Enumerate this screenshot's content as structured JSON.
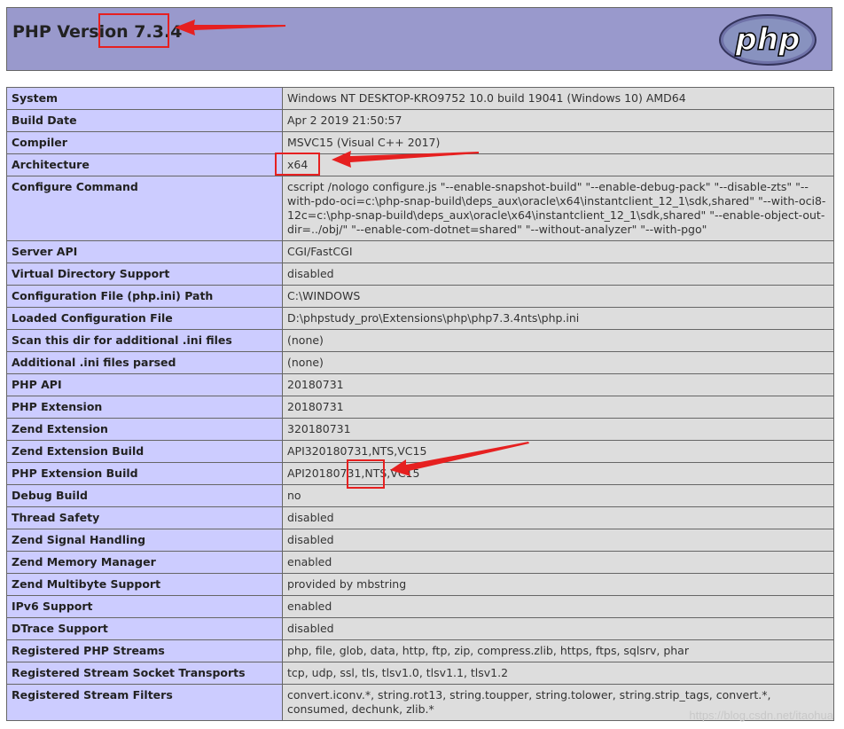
{
  "header": {
    "title": "PHP Version 7.3.4",
    "logo_text": "php"
  },
  "rows": [
    {
      "key": "System",
      "value": "Windows NT DESKTOP-KRO9752 10.0 build 19041 (Windows 10) AMD64"
    },
    {
      "key": "Build Date",
      "value": "Apr 2 2019 21:50:57"
    },
    {
      "key": "Compiler",
      "value": "MSVC15 (Visual C++ 2017)"
    },
    {
      "key": "Architecture",
      "value": "x64"
    },
    {
      "key": "Configure Command",
      "value": "cscript /nologo configure.js \"--enable-snapshot-build\" \"--enable-debug-pack\" \"--disable-zts\" \"--with-pdo-oci=c:\\php-snap-build\\deps_aux\\oracle\\x64\\instantclient_12_1\\sdk,shared\" \"--with-oci8-12c=c:\\php-snap-build\\deps_aux\\oracle\\x64\\instantclient_12_1\\sdk,shared\" \"--enable-object-out-dir=../obj/\" \"--enable-com-dotnet=shared\" \"--without-analyzer\" \"--with-pgo\""
    },
    {
      "key": "Server API",
      "value": "CGI/FastCGI"
    },
    {
      "key": "Virtual Directory Support",
      "value": "disabled"
    },
    {
      "key": "Configuration File (php.ini) Path",
      "value": "C:\\WINDOWS"
    },
    {
      "key": "Loaded Configuration File",
      "value": "D:\\phpstudy_pro\\Extensions\\php\\php7.3.4nts\\php.ini"
    },
    {
      "key": "Scan this dir for additional .ini files",
      "value": "(none)"
    },
    {
      "key": "Additional .ini files parsed",
      "value": "(none)"
    },
    {
      "key": "PHP API",
      "value": "20180731"
    },
    {
      "key": "PHP Extension",
      "value": "20180731"
    },
    {
      "key": "Zend Extension",
      "value": "320180731"
    },
    {
      "key": "Zend Extension Build",
      "value": "API320180731,NTS,VC15"
    },
    {
      "key": "PHP Extension Build",
      "value": "API20180731,NTS,VC15"
    },
    {
      "key": "Debug Build",
      "value": "no"
    },
    {
      "key": "Thread Safety",
      "value": "disabled"
    },
    {
      "key": "Zend Signal Handling",
      "value": "disabled"
    },
    {
      "key": "Zend Memory Manager",
      "value": "enabled"
    },
    {
      "key": "Zend Multibyte Support",
      "value": "provided by mbstring"
    },
    {
      "key": "IPv6 Support",
      "value": "enabled"
    },
    {
      "key": "DTrace Support",
      "value": "disabled"
    },
    {
      "key": "Registered PHP Streams",
      "value": "php, file, glob, data, http, ftp, zip, compress.zlib, https, ftps, sqlsrv, phar"
    },
    {
      "key": "Registered Stream Socket Transports",
      "value": "tcp, udp, ssl, tls, tlsv1.0, tlsv1.1, tlsv1.2"
    },
    {
      "key": "Registered Stream Filters",
      "value": "convert.iconv.*, string.rot13, string.toupper, string.tolower, string.strip_tags, convert.*, consumed, dechunk, zlib.*"
    }
  ],
  "watermark": "https://blog.csdn.net/itaohua",
  "colors": {
    "header_bg": "#9999cc",
    "key_bg": "#ccccff",
    "value_bg": "#dddddd",
    "annotation": "#e62020"
  }
}
